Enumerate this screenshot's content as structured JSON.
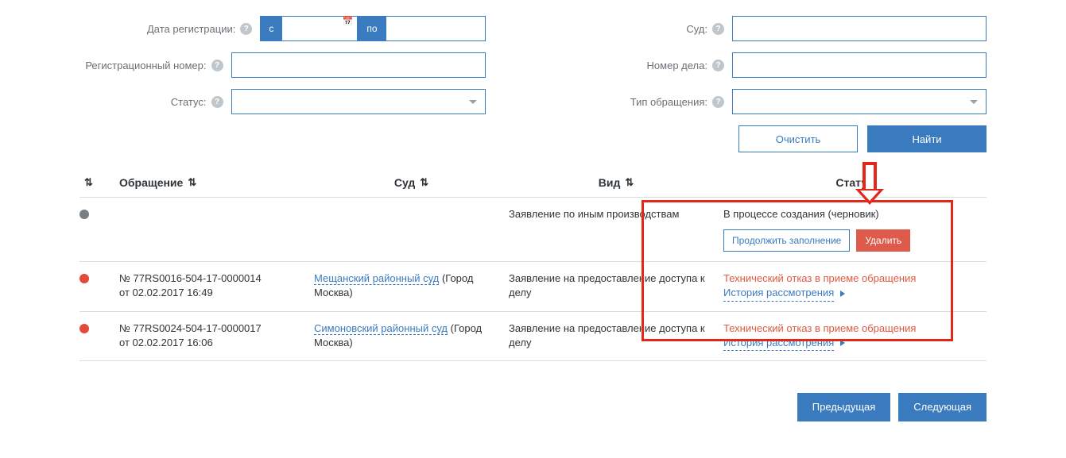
{
  "filters": {
    "reg_date_label": "Дата регистрации:",
    "date_from_prefix": "с",
    "date_to_prefix": "по",
    "reg_number_label": "Регистрационный номер:",
    "status_label": "Статус:",
    "court_label": "Суд:",
    "case_number_label": "Номер дела:",
    "appeal_type_label": "Тип обращения:"
  },
  "buttons": {
    "clear": "Очистить",
    "find": "Найти",
    "prev": "Предыдущая",
    "next": "Следующая",
    "continue_fill": "Продолжить заполнение",
    "delete": "Удалить"
  },
  "table": {
    "headers": {
      "appeal": "Обращение",
      "court": "Суд",
      "type": "Вид",
      "status": "Статус"
    },
    "rows": [
      {
        "dot": "gray",
        "appeal_line1": "",
        "appeal_line2": "",
        "court_link": "",
        "court_suffix": "",
        "type": "Заявление по иным производствам",
        "status_main": "В процессе создания (черновик)",
        "status_red": "",
        "history": "",
        "show_actions": true
      },
      {
        "dot": "red",
        "appeal_line1": "№ 77RS0016-504-17-0000014",
        "appeal_line2": "от 02.02.2017 16:49",
        "court_link": "Мещанский районный суд",
        "court_suffix": " (Город Москва)",
        "type": "Заявление на предоставление доступа к делу",
        "status_main": "",
        "status_red": "Технический отказ в приеме обращения",
        "history": "История рассмотрения",
        "show_actions": false
      },
      {
        "dot": "red",
        "appeal_line1": "№ 77RS0024-504-17-0000017",
        "appeal_line2": "от 02.02.2017 16:06",
        "court_link": "Симоновский районный суд",
        "court_suffix": " (Город Москва)",
        "type": "Заявление на предоставление доступа к делу",
        "status_main": "",
        "status_red": "Технический отказ в приеме обращения",
        "history": "История рассмотрения",
        "show_actions": false
      }
    ]
  }
}
